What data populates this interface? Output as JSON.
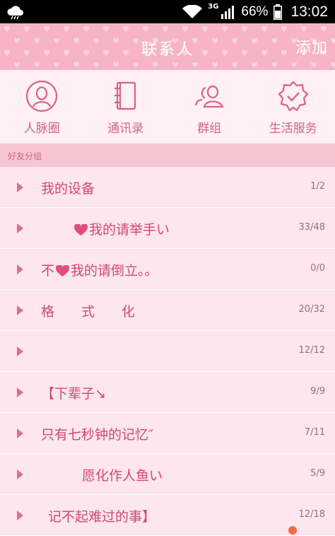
{
  "status_bar": {
    "network": "3G",
    "battery": "66%",
    "time": "13:02",
    "icons": [
      "cloud-icon",
      "wifi-icon",
      "signal-icon",
      "battery-icon"
    ]
  },
  "header": {
    "title": "联系人",
    "add_label": "添加"
  },
  "tabs": [
    {
      "label": "人脉圈",
      "icon": "person-circle-icon"
    },
    {
      "label": "通讯录",
      "icon": "address-book-icon"
    },
    {
      "label": "群组",
      "icon": "group-icon"
    },
    {
      "label": "生活服务",
      "icon": "badge-check-icon"
    }
  ],
  "section": {
    "title": "好友分组"
  },
  "groups": [
    {
      "name": "我的设备",
      "count": "1/2"
    },
    {
      "name_before": "",
      "name_after": "我的请举手い",
      "count": "33/48"
    },
    {
      "name_before": "不",
      "name_after": "我的请倒立。。",
      "count": "0/0"
    },
    {
      "name": "格　　式　　化",
      "count": "20/32"
    },
    {
      "name": "",
      "count": "12/12"
    },
    {
      "name": "【下辈子↘",
      "count": "9/9"
    },
    {
      "name": "只有七秒钟的记忆″",
      "count": "7/11"
    },
    {
      "name": "愿化作人鱼い",
      "count": "5/9"
    },
    {
      "name": "记不起难过的事】",
      "count": "12/18"
    }
  ],
  "colors": {
    "title_bar": "#f6b4c6",
    "accent": "#d24676",
    "row_bg": "#fde6ee",
    "section_bg": "#f8c5d3"
  }
}
